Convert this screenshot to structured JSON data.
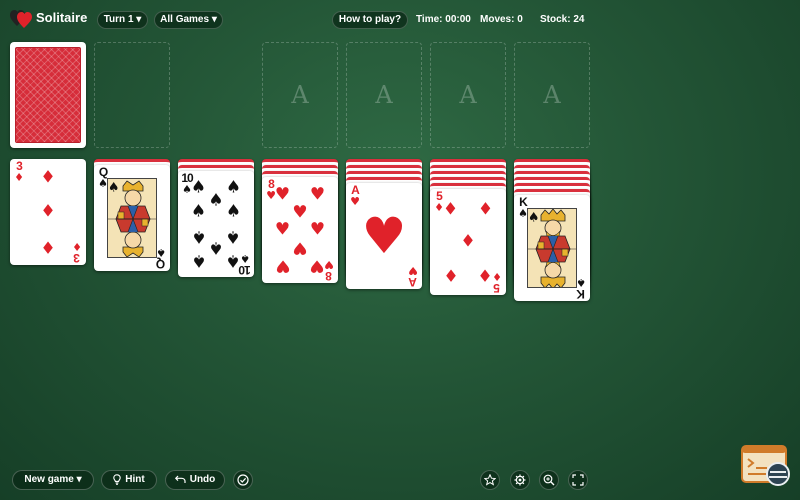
{
  "header": {
    "app_title": "Solitaire",
    "turn_label": "Turn 1 ▾",
    "games_label": "All Games ▾",
    "how_to_label": "How to play?",
    "time_label": "Time: 00:00",
    "moves_label": "Moves: 0",
    "stock_label": "Stock: 24"
  },
  "foundations": [
    "A",
    "A",
    "A",
    "A"
  ],
  "tableau": [
    {
      "hidden": 0,
      "rank": "3",
      "suit": "♦",
      "color": "red"
    },
    {
      "hidden": 1,
      "rank": "Q",
      "suit": "♠",
      "color": "black"
    },
    {
      "hidden": 2,
      "rank": "10",
      "suit": "♠",
      "color": "black"
    },
    {
      "hidden": 3,
      "rank": "8",
      "suit": "♥",
      "color": "red"
    },
    {
      "hidden": 4,
      "rank": "A",
      "suit": "♥",
      "color": "red"
    },
    {
      "hidden": 5,
      "rank": "5",
      "suit": "♦",
      "color": "red"
    },
    {
      "hidden": 6,
      "rank": "K",
      "suit": "♠",
      "color": "black"
    }
  ],
  "footer": {
    "new_game_label": "New game ▾",
    "hint_label": "Hint",
    "undo_label": "Undo"
  },
  "icons": {
    "logo": "hearts-logo-icon",
    "hint": "lightbulb-icon",
    "undo": "undo-arrow-icon",
    "autocomplete": "check-circle-icon",
    "favorite": "star-icon",
    "settings": "gear-icon",
    "zoom": "zoom-in-icon",
    "fullscreen": "fullscreen-icon"
  },
  "colors": {
    "felt": "#235536",
    "card_red": "#e0222a",
    "card_back": "#d62d3a"
  }
}
